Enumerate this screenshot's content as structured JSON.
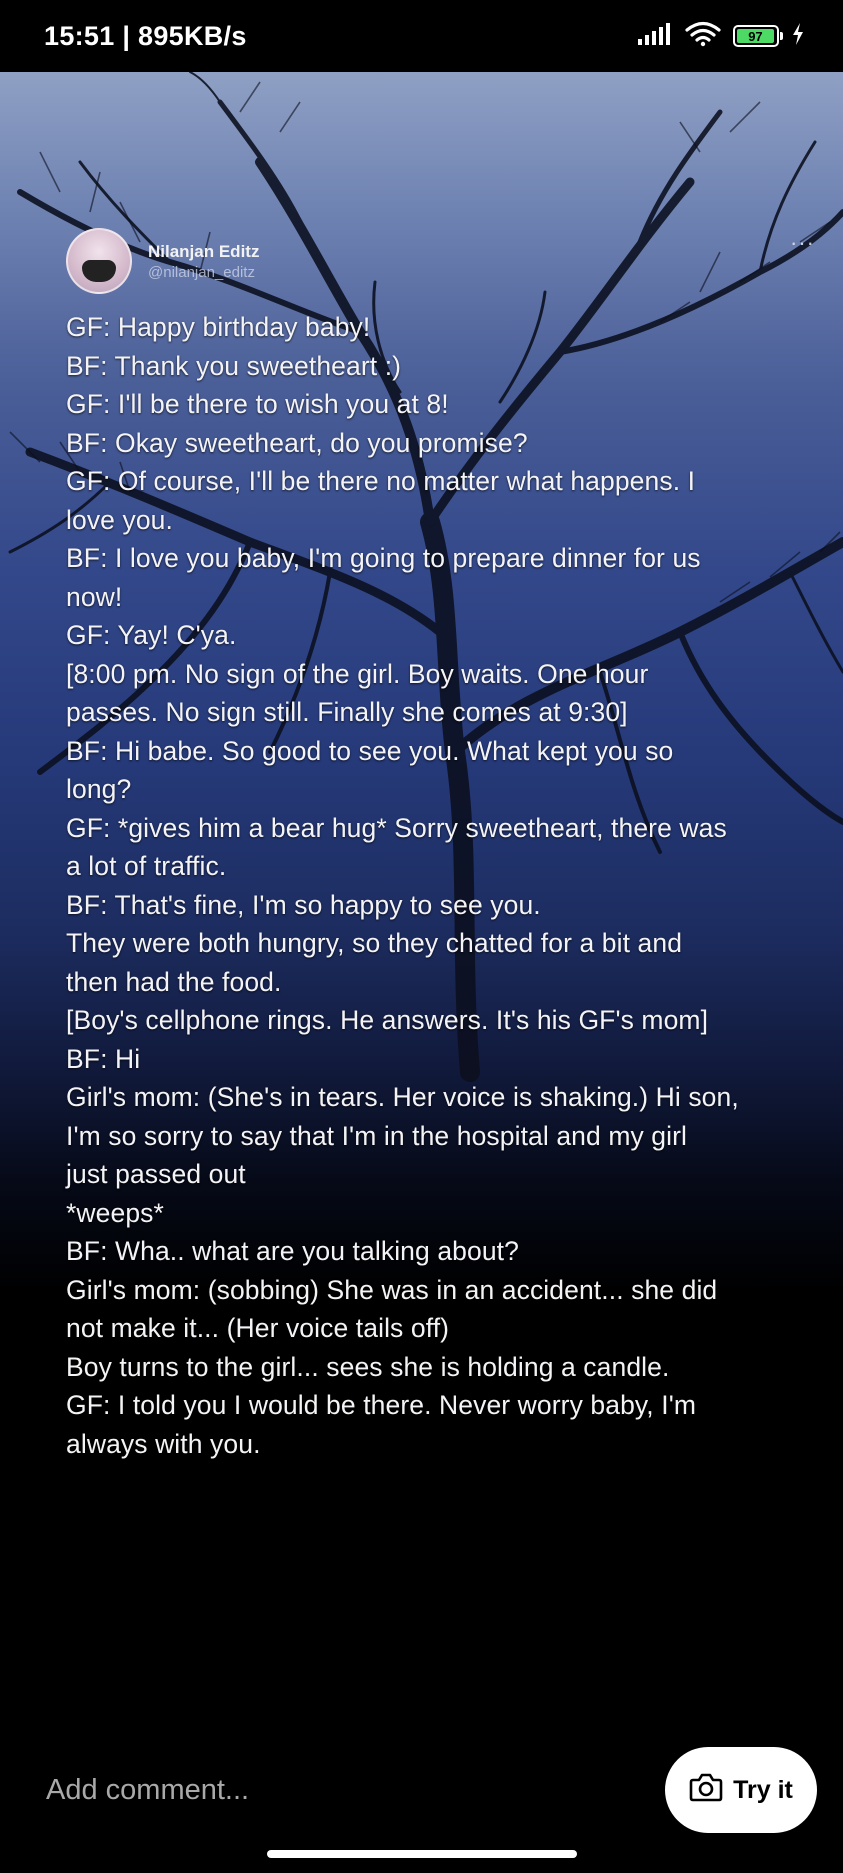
{
  "status_bar": {
    "time_speed": "15:51 | 895KB/s",
    "battery_level": "97",
    "battery_color": "#4cd964"
  },
  "post": {
    "author_name": "Nilanjan Editz",
    "author_handle": "@nilanjan_editz",
    "more_label": "···",
    "story_lines": [
      "GF: Happy birthday baby!",
      "BF: Thank you sweetheart :)",
      "GF: I'll be there to wish you at 8!",
      "BF: Okay sweetheart, do you promise?",
      "GF: Of course, I'll be there no matter what happens. I",
      "love you.",
      "BF: I love you baby, I'm going to prepare dinner for us",
      "now!",
      "GF: Yay! C'ya.",
      "[8:00 pm. No sign of the girl. Boy waits. One hour",
      "passes. No sign still. Finally she comes at 9:30]",
      "BF: Hi babe. So good to see you. What kept you so",
      "long?",
      "GF: *gives him a bear hug* Sorry sweetheart, there was",
      "a lot of traffic.",
      "BF: That's fine, I'm so happy to see you.",
      "They were both hungry, so they chatted for a bit and",
      "then had the food.",
      "[Boy's cellphone rings. He answers. It's his GF's mom]",
      "BF: Hi",
      "Girl's mom: (She's in tears. Her voice is shaking.) Hi son,",
      "I'm so sorry to say that I'm in the hospital and my girl",
      "just passed out",
      "*weeps*",
      "BF: Wha.. what are you talking about?",
      "Girl's mom: (sobbing) She was in an accident... she did",
      "not make it... (Her voice tails off)",
      "Boy turns to the girl... sees she is holding a candle.",
      "GF: I told you I would be there. Never worry baby, I'm",
      "always with you."
    ]
  },
  "comment_bar": {
    "placeholder": "Add comment...",
    "try_label": "Try it"
  },
  "icons": {
    "signal": "signal-icon",
    "wifi": "wifi-icon",
    "battery": "battery-icon",
    "charging": "charging-bolt-icon",
    "more": "more-options-icon",
    "camera": "camera-icon"
  }
}
